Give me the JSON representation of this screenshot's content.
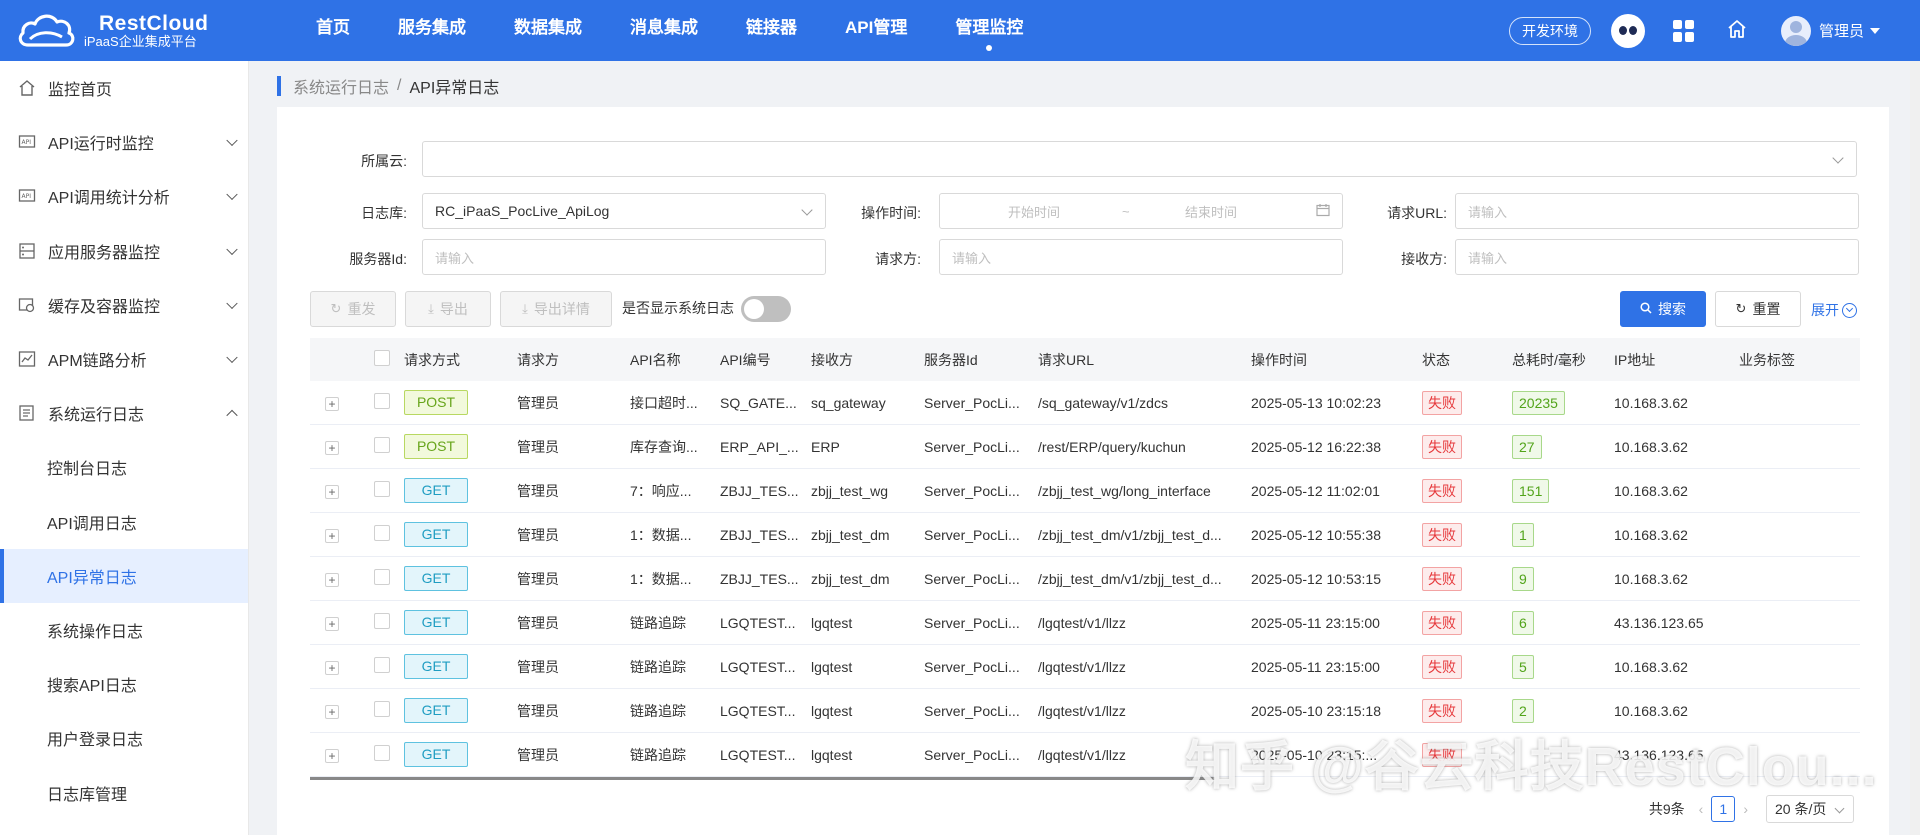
{
  "brand": {
    "name": "RestCloud",
    "subtitle": "iPaaS企业集成平台"
  },
  "topnav": [
    {
      "label": "首页"
    },
    {
      "label": "服务集成"
    },
    {
      "label": "数据集成"
    },
    {
      "label": "消息集成"
    },
    {
      "label": "链接器"
    },
    {
      "label": "API管理"
    },
    {
      "label": "管理监控",
      "active": true
    }
  ],
  "header": {
    "env": "开发环境",
    "user": "管理员"
  },
  "sidebar": {
    "items": [
      {
        "label": "监控首页",
        "icon": "home-icon"
      },
      {
        "label": "API运行时监控",
        "icon": "api-monitor-icon"
      },
      {
        "label": "API调用统计分析",
        "icon": "api-stats-icon"
      },
      {
        "label": "应用服务器监控",
        "icon": "server-icon"
      },
      {
        "label": "缓存及容器监控",
        "icon": "cache-icon"
      },
      {
        "label": "APM链路分析",
        "icon": "chart-line-icon"
      },
      {
        "label": "系统运行日志",
        "icon": "log-icon"
      }
    ],
    "sub_items": [
      {
        "label": "控制台日志"
      },
      {
        "label": "API调用日志"
      },
      {
        "label": "API异常日志",
        "active": true
      },
      {
        "label": "系统操作日志"
      },
      {
        "label": "搜索API日志"
      },
      {
        "label": "用户登录日志"
      },
      {
        "label": "日志库管理"
      }
    ]
  },
  "breadcrumb": {
    "parent": "系统运行日志",
    "separator": "/",
    "current": "API异常日志"
  },
  "filters": {
    "cloud_label": "所属云:",
    "logdb_label": "日志库:",
    "logdb_value": "RC_iPaaS_PocLive_ApiLog",
    "optime_label": "操作时间:",
    "start_placeholder": "开始时间",
    "range_sep": "~",
    "end_placeholder": "结束时间",
    "url_label": "请求URL:",
    "url_placeholder": "请输入",
    "server_label": "服务器Id:",
    "server_placeholder": "请输入",
    "requester_label": "请求方:",
    "requester_placeholder": "请输入",
    "receiver_label": "接收方:",
    "receiver_placeholder": "请输入"
  },
  "toolbar": {
    "resend": "重发",
    "export": "导出",
    "export_detail": "导出详情",
    "show_system_log": "是否显示系统日志",
    "search": "搜索",
    "reset": "重置",
    "expand": "展开"
  },
  "table": {
    "columns": [
      "请求方式",
      "请求方",
      "API名称",
      "API编号",
      "接收方",
      "服务器Id",
      "请求URL",
      "操作时间",
      "状态",
      "总耗时/毫秒",
      "IP地址",
      "业务标签"
    ],
    "rows": [
      {
        "method": "POST",
        "requester": "管理员",
        "api_name": "接口超时...",
        "api_code": "SQ_GATE...",
        "receiver": "sq_gateway",
        "server": "Server_PocLi...",
        "url": "/sq_gateway/v1/zdcs",
        "time": "2025-05-13 10:02:23",
        "status": "失败",
        "cost": "20235",
        "ip": "10.168.3.62",
        "tag": ""
      },
      {
        "method": "POST",
        "requester": "管理员",
        "api_name": "库存查询...",
        "api_code": "ERP_API_...",
        "receiver": "ERP",
        "server": "Server_PocLi...",
        "url": "/rest/ERP/query/kuchun",
        "time": "2025-05-12 16:22:38",
        "status": "失败",
        "cost": "27",
        "ip": "10.168.3.62",
        "tag": ""
      },
      {
        "method": "GET",
        "requester": "管理员",
        "api_name": "7：响应...",
        "api_code": "ZBJJ_TES...",
        "receiver": "zbjj_test_wg",
        "server": "Server_PocLi...",
        "url": "/zbjj_test_wg/long_interface",
        "time": "2025-05-12 11:02:01",
        "status": "失败",
        "cost": "151",
        "ip": "10.168.3.62",
        "tag": ""
      },
      {
        "method": "GET",
        "requester": "管理员",
        "api_name": "1：数据...",
        "api_code": "ZBJJ_TES...",
        "receiver": "zbjj_test_dm",
        "server": "Server_PocLi...",
        "url": "/zbjj_test_dm/v1/zbjj_test_d...",
        "time": "2025-05-12 10:55:38",
        "status": "失败",
        "cost": "1",
        "ip": "10.168.3.62",
        "tag": ""
      },
      {
        "method": "GET",
        "requester": "管理员",
        "api_name": "1：数据...",
        "api_code": "ZBJJ_TES...",
        "receiver": "zbjj_test_dm",
        "server": "Server_PocLi...",
        "url": "/zbjj_test_dm/v1/zbjj_test_d...",
        "time": "2025-05-12 10:53:15",
        "status": "失败",
        "cost": "9",
        "ip": "10.168.3.62",
        "tag": ""
      },
      {
        "method": "GET",
        "requester": "管理员",
        "api_name": "链路追踪",
        "api_code": "LGQTEST...",
        "receiver": "lgqtest",
        "server": "Server_PocLi...",
        "url": "/lgqtest/v1/llzz",
        "time": "2025-05-11 23:15:00",
        "status": "失败",
        "cost": "6",
        "ip": "43.136.123.65",
        "tag": ""
      },
      {
        "method": "GET",
        "requester": "管理员",
        "api_name": "链路追踪",
        "api_code": "LGQTEST...",
        "receiver": "lgqtest",
        "server": "Server_PocLi...",
        "url": "/lgqtest/v1/llzz",
        "time": "2025-05-11 23:15:00",
        "status": "失败",
        "cost": "5",
        "ip": "10.168.3.62",
        "tag": ""
      },
      {
        "method": "GET",
        "requester": "管理员",
        "api_name": "链路追踪",
        "api_code": "LGQTEST...",
        "receiver": "lgqtest",
        "server": "Server_PocLi...",
        "url": "/lgqtest/v1/llzz",
        "time": "2025-05-10 23:15:18",
        "status": "失败",
        "cost": "2",
        "ip": "10.168.3.62",
        "tag": ""
      },
      {
        "method": "GET",
        "requester": "管理员",
        "api_name": "链路追踪",
        "api_code": "LGQTEST...",
        "receiver": "lgqtest",
        "server": "Server_PocLi...",
        "url": "/lgqtest/v1/llzz",
        "time": "2025-05-10 23:15:...",
        "status": "失败",
        "cost": "",
        "ip": "43.136.123.65",
        "tag": ""
      }
    ]
  },
  "pagination": {
    "total": "共9条",
    "current_page": "1",
    "page_size": "20 条/页"
  },
  "watermark": "知乎 @谷云科技RestClou...",
  "colors": {
    "primary": "#2f72e6",
    "fail": "#e6393c",
    "success": "#52a41a"
  }
}
